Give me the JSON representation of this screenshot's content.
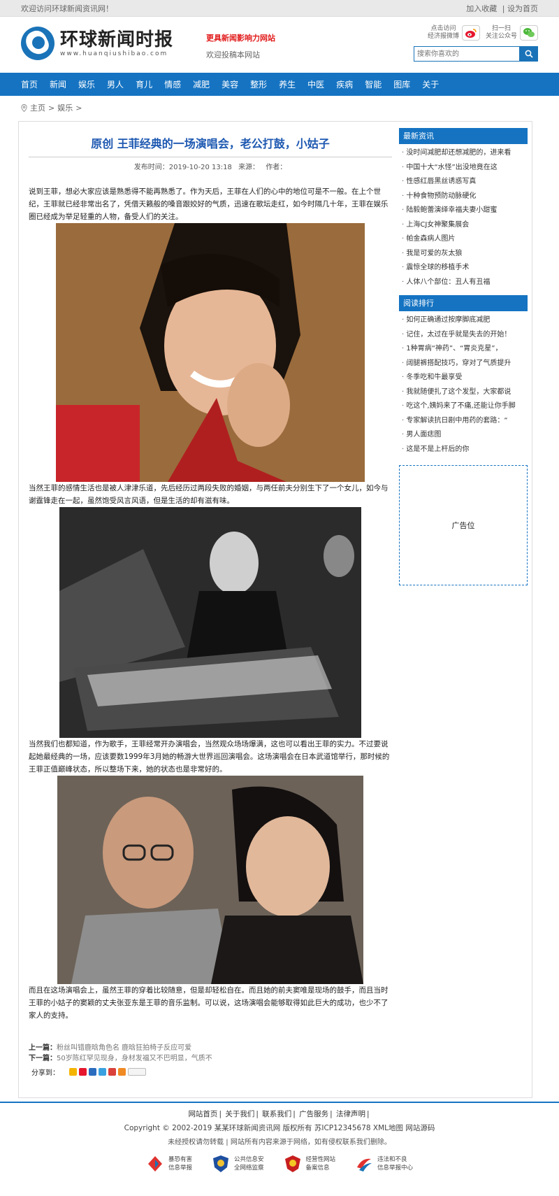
{
  "topbar": {
    "welcome": "欢迎访问环球新闻资讯网！",
    "favorite": "加入收藏",
    "separator": "|",
    "homepage": "设为首页"
  },
  "header": {
    "logo_cn": "环球新闻时报",
    "logo_en": "www.huanqiushibao.com",
    "slogan_main": "更具新闻影响力网站",
    "slogan_sub": "欢迎投稿本网站",
    "weibo_line1": "点击访问",
    "weibo_line2": "经济报微博",
    "wechat_line1": "扫一扫",
    "wechat_line2": "关注公众号",
    "search_placeholder": "搜索你喜欢的"
  },
  "nav": {
    "items": [
      "首页",
      "新闻",
      "娱乐",
      "男人",
      "育儿",
      "情感",
      "减肥",
      "美容",
      "整形",
      "养生",
      "中医",
      "疾病",
      "智能",
      "图库",
      "关于"
    ]
  },
  "breadcrumb": {
    "home": "主页",
    "sep1": ">",
    "section": "娱乐",
    "sep2": ">"
  },
  "article": {
    "title": "原创 王菲经典的一场演唱会，老公打鼓，小姑子",
    "publish_label": "发布时间：",
    "publish_time": "2019-10-20 13:18",
    "source_label": "来源：",
    "author_label": "作者：",
    "para1": "说到王菲，想必大家应该是熟悉得不能再熟悉了。作为天后，王菲在人们的心中的地位可是不一般。在上个世纪，王菲就已经非常出名了，凭借天籁般的嗓音跟姣好的气质，迅速在歌坛走红，如今时隔几十年，王菲在娱乐圈已经成为举足轻重的人物，备受人们的关注。",
    "para2": "当然王菲的感情生活也是被人津津乐道，先后经历过两段失败的婚姻，与两任前夫分别生下了一个女儿，如今与谢霆锋走在一起，虽然饱受风言风语，但是生活的却有滋有味。",
    "para3": "当然我们也都知道，作为歌手，王菲经常开办演唱会，当然观众场场爆满，这也可以看出王菲的实力。不过要说起她最经典的一场，应该要数1999年3月她的畅游大世界巡回演唱会。这场演唱会在日本武道馆举行，那时候的王菲正值巅峰状态，所以整场下来，她的状态也是非常好的。",
    "para4": "而且在这场演唱会上，虽然王菲的穿着比较随意，但是却轻松自在。而且她的前夫窦唯是现场的鼓手，而且当时王菲的小姑子的窦颖的丈夫张亚东是王菲的音乐监制。可以说，这场演唱会能够取得如此巨大的成功，也少不了家人的支持。",
    "prev_label": "上一篇：",
    "prev_link": "粉丝叫错鹿晗角色名 鹿晗狂拍椅子反应可爱",
    "next_label": "下一篇：",
    "next_link": "50岁陈红罕见现身，身材发福又不巴明显，气质不",
    "share_label": "分享到："
  },
  "sidebar": {
    "latest_title": "最新资讯",
    "latest": [
      "没时间减肥却还想减肥的，进来看",
      "中国十大“水怪”出没地竟在这",
      "性感红唇黑丝诱惑写真",
      "十种食物预防动脉硬化",
      "陆毅鲍蕾演绎幸福夫妻小甜蜜",
      "上海CJ女神聚集展会",
      "帕金森病人图片",
      "我是可爱的灰太狼",
      "震惊全球的移植手术",
      "人体八个部位：丑人有丑福"
    ],
    "ranking_title": "阅读排行",
    "ranking": [
      "如何正确通过按摩脚底减肥",
      "记住，太过在乎就是失去的开始！",
      "1种胃病“神药”、“胃炎克星”，",
      "阔腿裤搭配技巧，穿对了气质提升",
      "冬季吃和牛最享受",
      "我就随便扎了这个发型，大家都说",
      "吃这个,姨妈来了不痛,还能让你手脚",
      "专家解读抗日剧中用药的套路：“",
      "男人面痣图",
      "这是不是上杆后的你"
    ],
    "ad_label": "广告位"
  },
  "footer": {
    "links": [
      "网站首页",
      "关于我们",
      "联系我们",
      "广告服务",
      "法律声明"
    ],
    "copyright": "Copyright © 2002-2019 某某环球新闻资讯网 版权所有  苏ICP12345678  XML地图  网站源码",
    "notice": "未经授权请勿转载 | 网站所有内容来源于网络，如有侵权联系我们删除。",
    "badges": [
      {
        "line1": "暴恐有害",
        "line2": "信息举报"
      },
      {
        "line1": "公共信息安",
        "line2": "全网络监察"
      },
      {
        "line1": "经营性网站",
        "line2": "备案信息"
      },
      {
        "line1": "违法和不良",
        "line2": "信息举报中心"
      }
    ]
  },
  "colors": {
    "brand_blue": "#1573c2",
    "title_blue": "#1d58b1",
    "slogan_red": "#e21b1b"
  }
}
